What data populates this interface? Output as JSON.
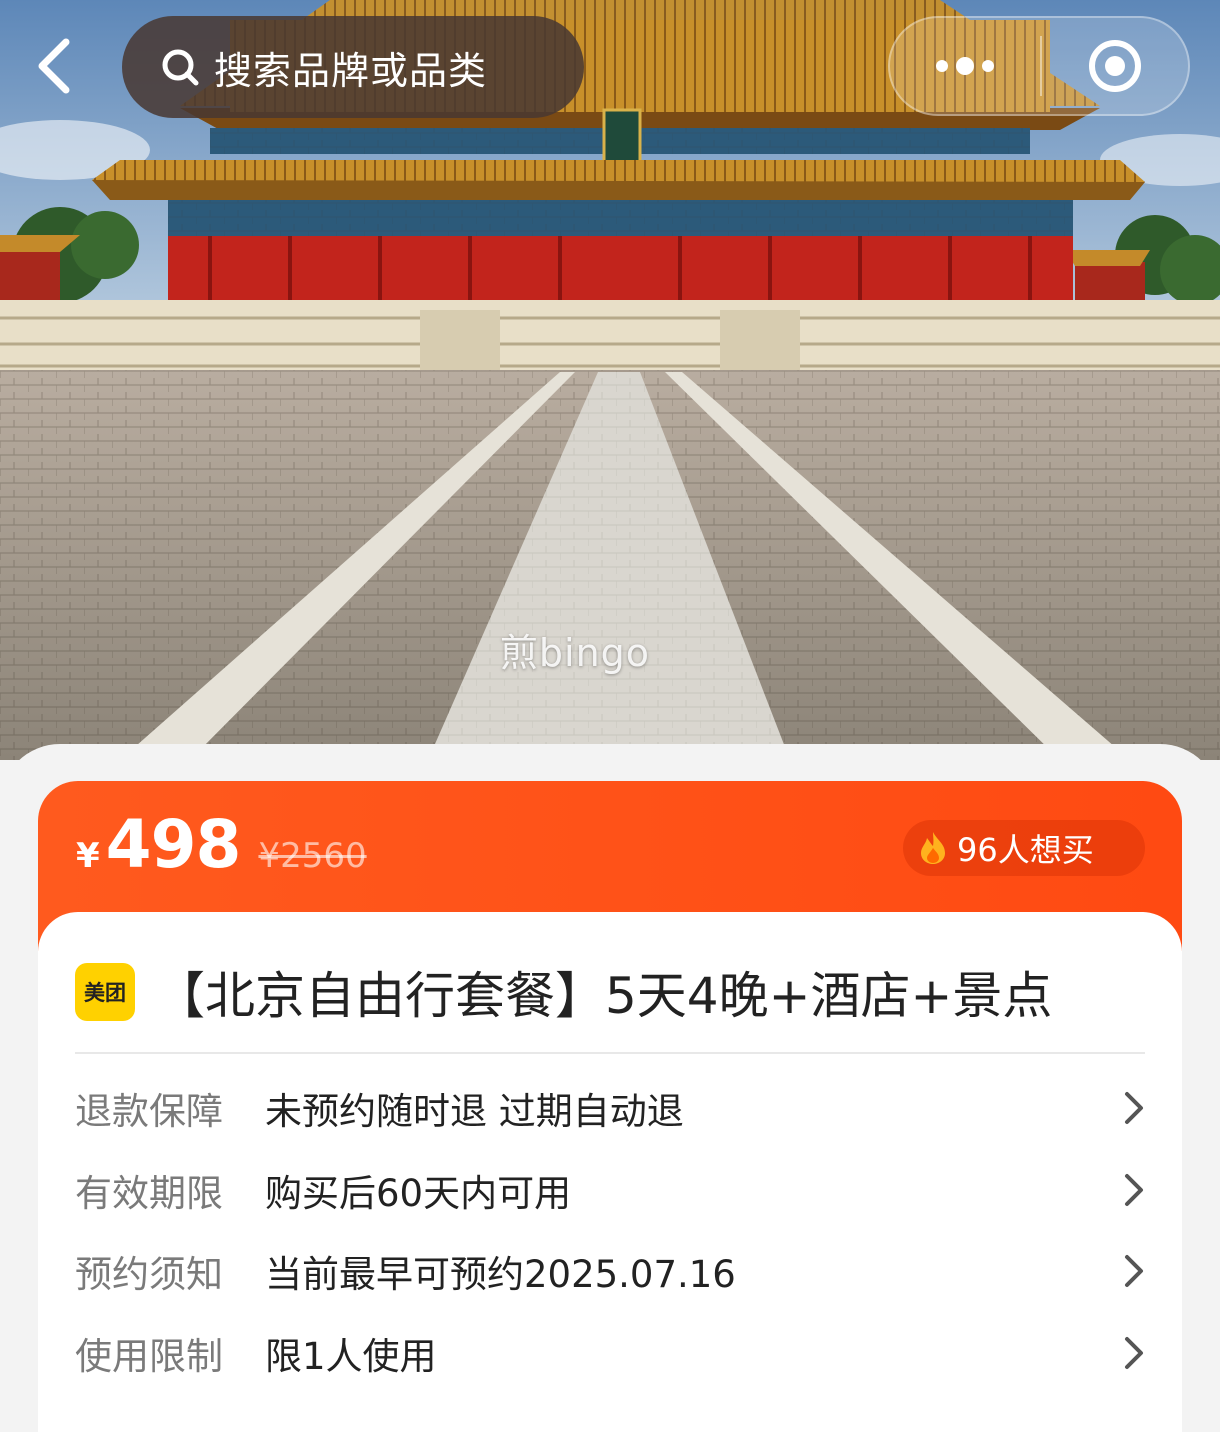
{
  "hero": {
    "watermark": "煎bingo",
    "image_desc_icon": "palace-photo"
  },
  "topbar": {
    "back_icon": "chevron-left-icon",
    "search_placeholder": "搜索品牌或品类",
    "more_icon": "more-dots-icon",
    "close_icon": "target-circle-icon"
  },
  "price": {
    "currency": "¥",
    "current": "498",
    "original": "¥2560",
    "hot_icon": "flame-icon",
    "want_count": "96人想买"
  },
  "product": {
    "brand_logo_text": "美团",
    "title": "【北京自由行套餐】5天4晚+酒店+景点"
  },
  "info_rows": [
    {
      "label": "退款保障",
      "value": "未预约随时退 过期自动退"
    },
    {
      "label": "有效期限",
      "value": "购买后60天内可用"
    },
    {
      "label": "预约须知",
      "value": "当前最早可预约2025.07.16"
    },
    {
      "label": "使用限制",
      "value": "限1人使用"
    }
  ],
  "colors": {
    "accent": "#ff4a12",
    "brand_yellow": "#ffd100",
    "label_gray": "#7a7a7a",
    "text_dark": "#222222"
  }
}
